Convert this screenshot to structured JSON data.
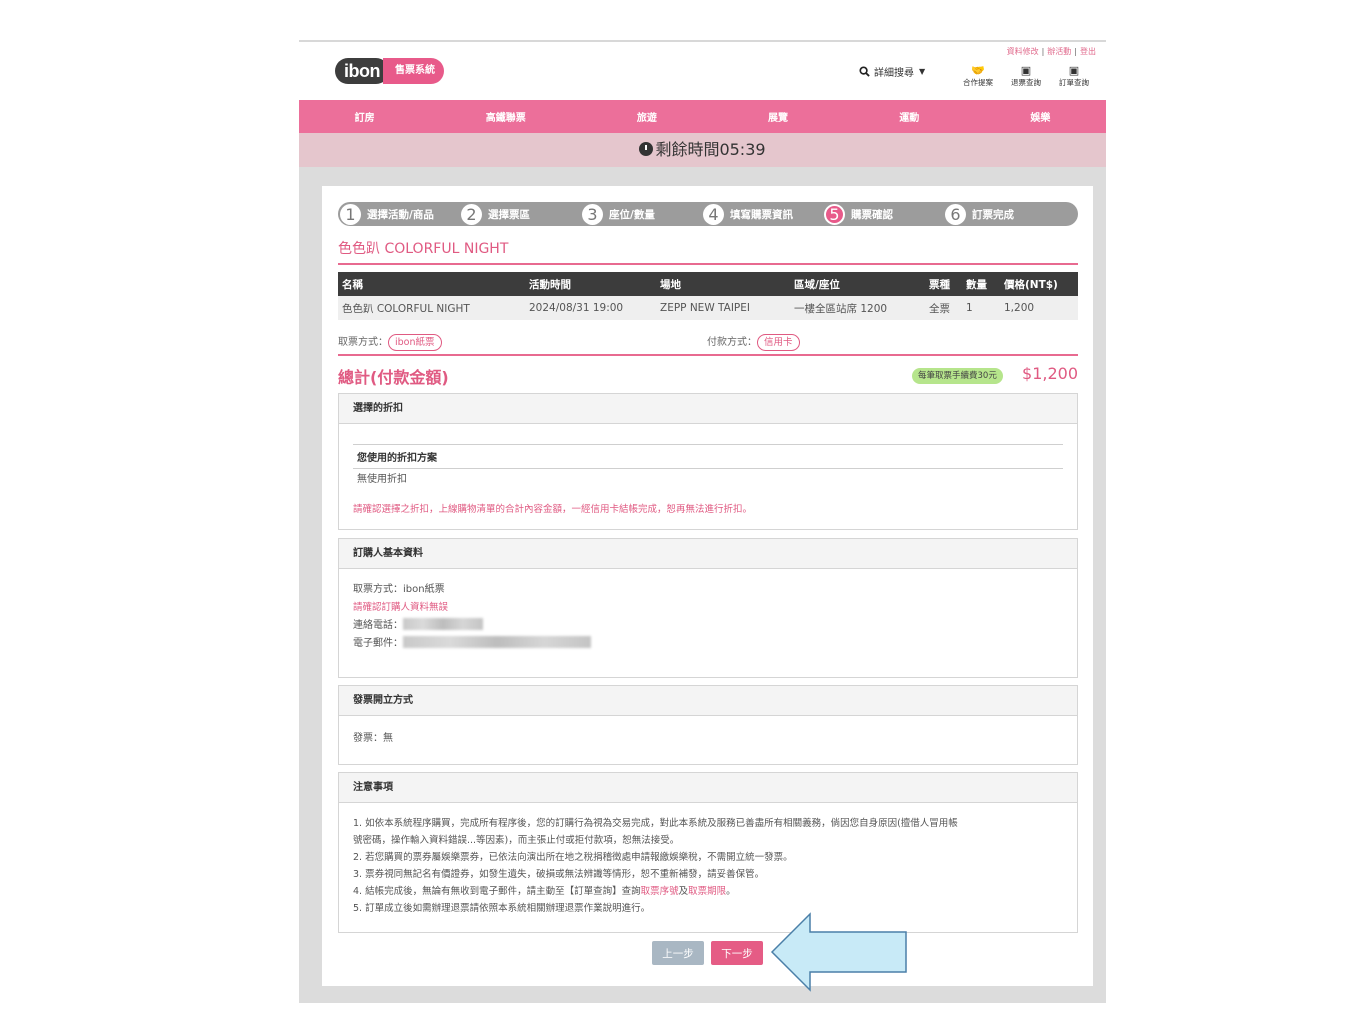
{
  "header": {
    "logo_text": "ibon",
    "logo_sub": "售票系統",
    "search_label": "詳細搜尋",
    "top_links": [
      "資料修改",
      "辦活動",
      "登出"
    ],
    "quick_icons": [
      {
        "icon": "handshake-icon",
        "label": "合作提案"
      },
      {
        "icon": "document-icon",
        "label": "退票查詢"
      },
      {
        "icon": "document-icon",
        "label": "訂單查詢"
      }
    ]
  },
  "nav": {
    "items": [
      "訂房",
      "高鐵聯票",
      "旅遊",
      "展覽",
      "運動",
      "娛樂"
    ]
  },
  "timer": {
    "label": "剩餘時間05:39"
  },
  "steps": [
    {
      "num": "1",
      "label": "選擇活動/商品"
    },
    {
      "num": "2",
      "label": "選擇票區"
    },
    {
      "num": "3",
      "label": "座位/數量"
    },
    {
      "num": "4",
      "label": "填寫購票資訊"
    },
    {
      "num": "5",
      "label": "購票確認"
    },
    {
      "num": "6",
      "label": "訂票完成"
    }
  ],
  "event_title": "色色趴 COLORFUL NIGHT",
  "table": {
    "headers": [
      "名稱",
      "活動時間",
      "場地",
      "區域/座位",
      "票種",
      "數量",
      "價格(NT$)"
    ],
    "rows": [
      [
        "色色趴 COLORFUL NIGHT",
        "2024/08/31 19:00",
        "ZEPP NEW TAIPEI",
        "一樓全區站席 1200",
        "全票",
        "1",
        "1,200"
      ]
    ]
  },
  "methods": {
    "pickup_label": "取票方式：",
    "pickup_value": "ibon紙票",
    "payment_label": "付款方式：",
    "payment_value": "信用卡"
  },
  "total": {
    "label": "總計(付款金額)",
    "fee": "每筆取票手續費30元",
    "amount": "$1,200"
  },
  "discount": {
    "title": "選擇的折扣",
    "plan_title": "您使用的折扣方案",
    "plan_value": "無使用折扣",
    "warning": "請確認選擇之折扣，上線購物清單的合計內容金額，一經信用卡結帳完成，恕再無法進行折扣。"
  },
  "buyer": {
    "title": "訂購人基本資料",
    "pickup": "取票方式：ibon紙票",
    "confirm_note": "請確認訂購人資料無誤",
    "phone_label": "連絡電話：",
    "email_label": "電子郵件："
  },
  "invoice": {
    "title": "發票開立方式",
    "value": "發票：無"
  },
  "notes": {
    "title": "注意事項",
    "lines": [
      "1. 如依本系統程序購買，完成所有程序後，您的訂購行為視為交易完成，對此本系統及服務已善盡所有相關義務，倘因您自身原因(擅借人冒用帳",
      "號密碼，操作輸入資料錯誤...等因素)，而主張止付或拒付款項，恕無法接受。",
      "2. 若您購買的票券屬娛樂票券，已依法向演出所在地之稅捐稽徵處申請報繳娛樂稅，不需開立統一發票。",
      "3. 票券視同無記名有價證券，如發生遺失，破損或無法辨識等情形，恕不重新補發，請妥善保管。",
      "5. 訂單成立後如需辦理退票請依照本系統相關辦理退票作業說明進行。"
    ],
    "line4_a": "4. 結帳完成後，無論有無收到電子郵件，請主動至【訂單查詢】查詢",
    "line4_b": "取票序號",
    "line4_c": "及",
    "line4_d": "取票期限",
    "line4_e": "。"
  },
  "buttons": {
    "prev": "上一步",
    "next": "下一步"
  }
}
